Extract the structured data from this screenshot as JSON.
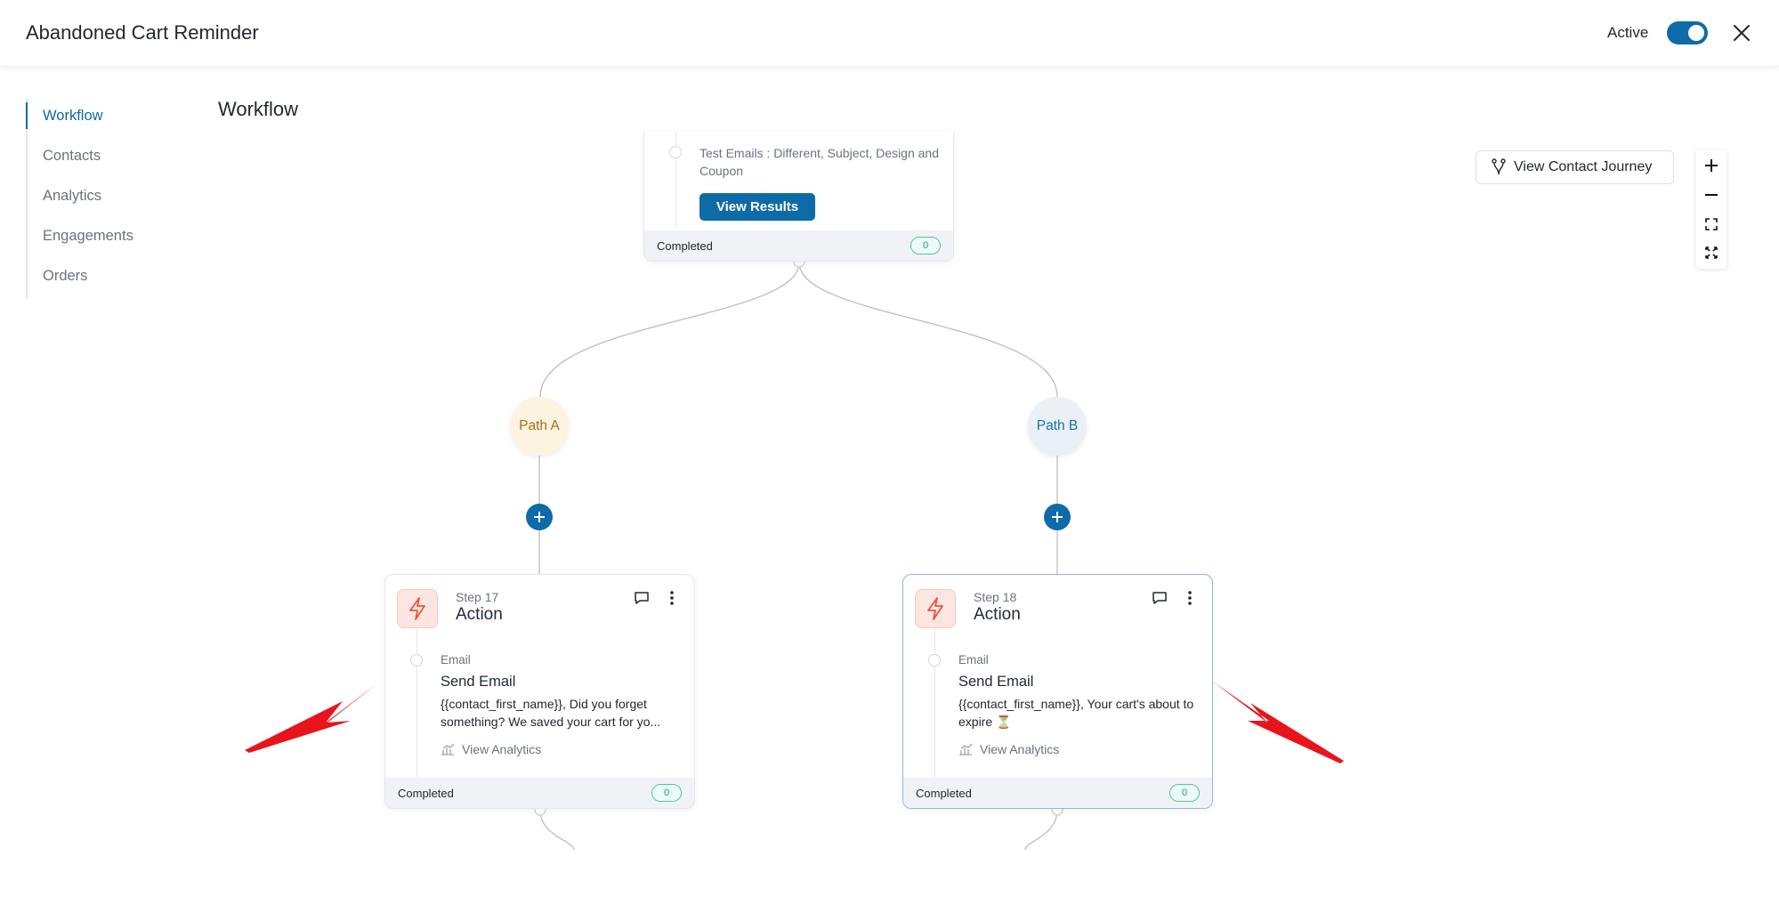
{
  "header": {
    "title": "Abandoned Cart Reminder",
    "active_label": "Active",
    "active_on": true
  },
  "sidebar": {
    "items": [
      {
        "label": "Workflow",
        "active": true
      },
      {
        "label": "Contacts"
      },
      {
        "label": "Analytics"
      },
      {
        "label": "Engagements"
      },
      {
        "label": "Orders"
      }
    ]
  },
  "main": {
    "heading": "Workflow",
    "journey_button": "View Contact Journey",
    "zoom_controls": [
      "plus-icon",
      "minus-icon",
      "fit-view-icon",
      "fullscreen-icon"
    ]
  },
  "top_card": {
    "description": "Test Emails : Different, Subject, Design and Coupon",
    "button": "View Results",
    "status": "Completed",
    "count": "0"
  },
  "paths": [
    {
      "label": "Path A",
      "color": "#a86f1c",
      "bg": "#fdf3e1"
    },
    {
      "label": "Path B",
      "color": "#1773b0",
      "bg": "#eaf0f5"
    }
  ],
  "steps": [
    {
      "step": "Step 17",
      "type": "Action",
      "email_label": "Email",
      "email_title": "Send Email",
      "email_desc": "{{contact_first_name}}, Did you forget something? We saved your cart for yo...",
      "analytics": "View Analytics",
      "status": "Completed",
      "count": "0"
    },
    {
      "step": "Step 18",
      "type": "Action",
      "email_label": "Email",
      "email_title": "Send Email",
      "email_desc": "{{contact_first_name}}, Your cart's about to expire ⏳",
      "analytics": "View Analytics",
      "status": "Completed",
      "count": "0"
    }
  ],
  "colors": {
    "accent": "#0e6ba8",
    "annotation_arrow": "#e8141c",
    "badge_green": "#20a174",
    "action_icon": "#e8543c"
  }
}
